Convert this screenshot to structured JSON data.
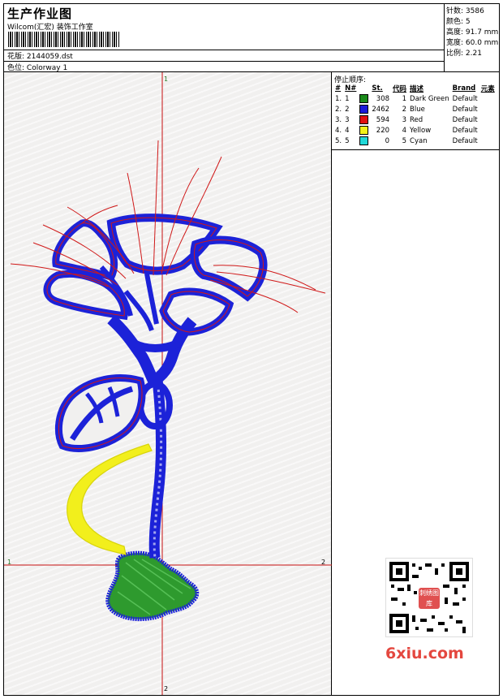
{
  "header": {
    "title": "生产作业图",
    "company": "Wilcom(汇宏) 装饰工作室",
    "design_label": "花版:",
    "design_value": "2144059.dst",
    "colorway_label": "色位:",
    "colorway_value": "Colorway 1"
  },
  "stats": {
    "stitches": "针数: 3586",
    "colors": "颜色: 5",
    "height": "高度: 91.7 mm",
    "width": "宽度: 60.0 mm",
    "scale": "比例: 2.21"
  },
  "canvas": {
    "axis_top": "1",
    "axis_left": "1",
    "axis_right": "2",
    "axis_bottom": "2"
  },
  "stop_sequence": {
    "title": "停止顺序:",
    "headers": [
      "#",
      "N#",
      "St.",
      "代码",
      "描述",
      "Brand",
      "元素"
    ],
    "rows": [
      {
        "idx": "1.",
        "n": "1",
        "st": "308",
        "code": "1",
        "desc": "Dark Green",
        "brand": "Default",
        "color": "#1a8a1a"
      },
      {
        "idx": "2.",
        "n": "2",
        "st": "2462",
        "code": "2",
        "desc": "Blue",
        "brand": "Default",
        "color": "#1a1ad8"
      },
      {
        "idx": "3.",
        "n": "3",
        "st": "594",
        "code": "3",
        "desc": "Red",
        "brand": "Default",
        "color": "#e01010"
      },
      {
        "idx": "4.",
        "n": "4",
        "st": "220",
        "code": "4",
        "desc": "Yellow",
        "brand": "Default",
        "color": "#f2f21a"
      },
      {
        "idx": "5.",
        "n": "5",
        "st": "0",
        "code": "5",
        "desc": "Cyan",
        "brand": "Default",
        "color": "#20d8d8"
      }
    ]
  },
  "watermark": {
    "site": "6xiu.com",
    "stamp": "刺绣图库"
  },
  "colors": {
    "blue": "#1c22d8",
    "red": "#d01818",
    "green": "#2e9a2e",
    "yellow": "#f2ef1c",
    "crosshair": "#c81010"
  }
}
